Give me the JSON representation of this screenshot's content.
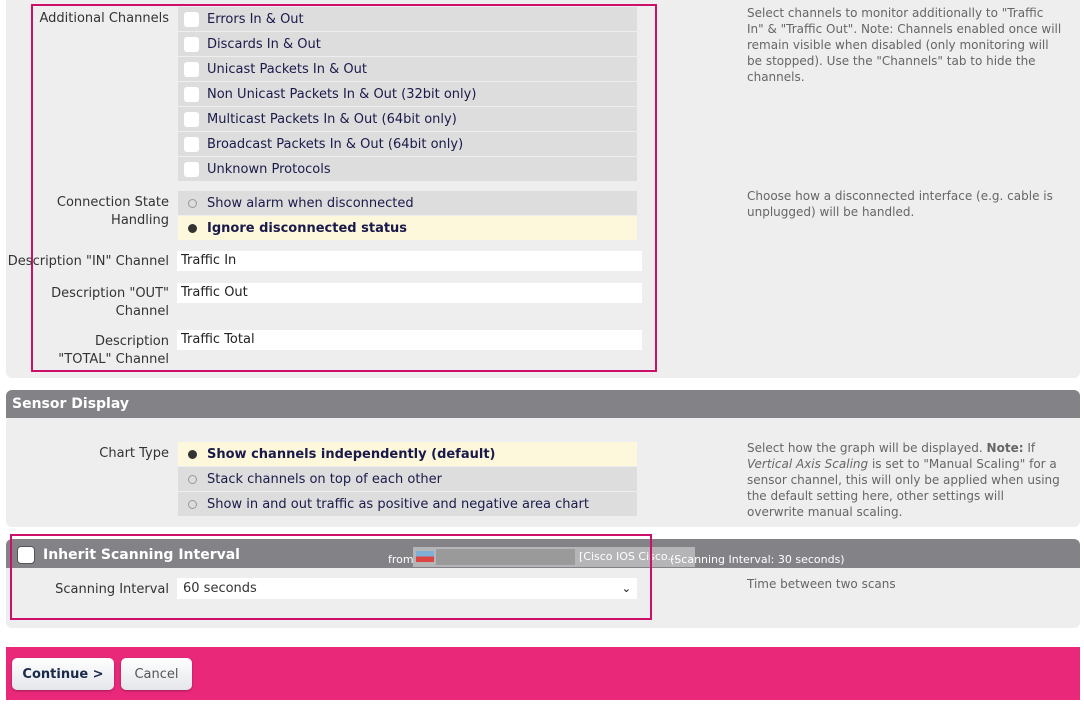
{
  "channels": {
    "label": "Additional Channels",
    "items": [
      {
        "label": "Errors In & Out",
        "checked": false
      },
      {
        "label": "Discards In & Out",
        "checked": false
      },
      {
        "label": "Unicast Packets In & Out",
        "checked": false
      },
      {
        "label": "Non Unicast Packets In & Out (32bit only)",
        "checked": false
      },
      {
        "label": "Multicast Packets In & Out (64bit only)",
        "checked": false
      },
      {
        "label": "Broadcast Packets In & Out (64bit only)",
        "checked": false
      },
      {
        "label": "Unknown Protocols",
        "checked": false
      }
    ],
    "help": "Select channels to monitor additionally to \"Traffic In\" & \"Traffic Out\". Note: Channels enabled once will remain visible when disabled (only monitoring will be stopped). Use the \"Channels\" tab to hide the channels."
  },
  "connection": {
    "label": "Connection State Handling",
    "options": [
      {
        "label": "Show alarm when disconnected",
        "selected": false
      },
      {
        "label": "Ignore disconnected status",
        "selected": true
      }
    ],
    "help": "Choose how a disconnected interface (e.g. cable is unplugged) will be handled."
  },
  "desc_in": {
    "label": "Description \"IN\" Channel",
    "value": "Traffic In"
  },
  "desc_out": {
    "label": "Description \"OUT\" Channel",
    "value": "Traffic Out"
  },
  "desc_total": {
    "label": "Description \"TOTAL\" Channel",
    "value": "Traffic Total"
  },
  "sensor_display": {
    "title": "Sensor Display",
    "chart_type_label": "Chart Type",
    "options": [
      {
        "label": "Show channels independently (default)",
        "selected": true
      },
      {
        "label": "Stack channels on top of each other",
        "selected": false
      },
      {
        "label": "Show in and out traffic as positive and negative area chart",
        "selected": false
      }
    ],
    "help_pre": "Select how the graph will be displayed. ",
    "help_note": "Note:",
    "help_mid": " If ",
    "help_em": "Vertical Axis Scaling",
    "help_post": " is set to \"Manual Scaling\" for a sensor channel, this will only be applied when using the default setting here, other settings will overwrite manual scaling."
  },
  "scanning": {
    "inherit_label": "Inherit Scanning Interval",
    "inherit_checked": false,
    "from": "from",
    "device": "[Cisco IOS Cisco...",
    "inherited": "(Scanning Interval: 30 seconds)",
    "label": "Scanning Interval",
    "value": "60 seconds",
    "help": "Time between two scans"
  },
  "footer": {
    "continue": "Continue >",
    "cancel": "Cancel",
    "color": "#e9287a"
  }
}
